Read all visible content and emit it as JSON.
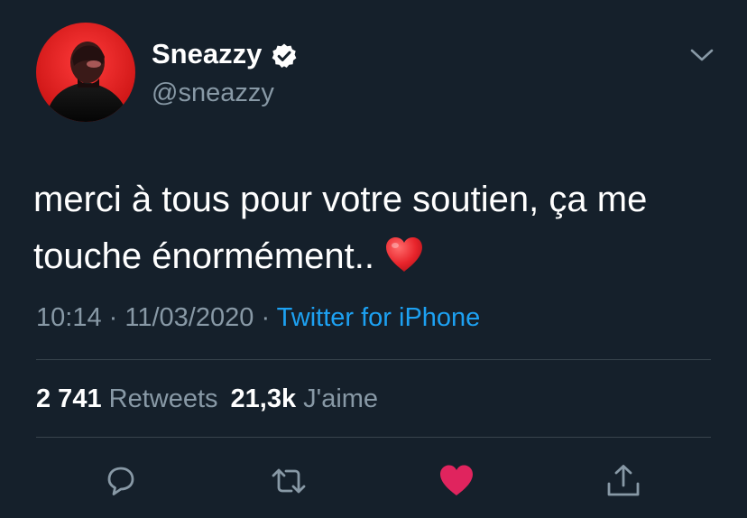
{
  "author": {
    "display_name": "Sneazzy",
    "handle": "@sneazzy",
    "verified": true,
    "avatar_icon": "profile-photo"
  },
  "tweet": {
    "text_line1": "merci à tous pour votre soutien, ça me",
    "text_line2": "touche énormément..",
    "emoji": "red-heart-emoji",
    "time": "10:14",
    "separator": "·",
    "date": "11/03/2020",
    "source": "Twitter for iPhone"
  },
  "stats": {
    "retweets_count": "2 741",
    "retweets_label": "Retweets",
    "likes_count": "21,3k",
    "likes_label": "J'aime"
  },
  "actions": [
    {
      "icon": "reply-icon"
    },
    {
      "icon": "retweet-icon"
    },
    {
      "icon": "like-heart-icon",
      "active": true
    },
    {
      "icon": "share-icon"
    }
  ],
  "colors": {
    "background": "#15202b",
    "text_primary": "#ffffff",
    "text_secondary": "#8899a6",
    "link": "#1da1f2",
    "like_active": "#e0245e",
    "divider": "#38444d"
  }
}
